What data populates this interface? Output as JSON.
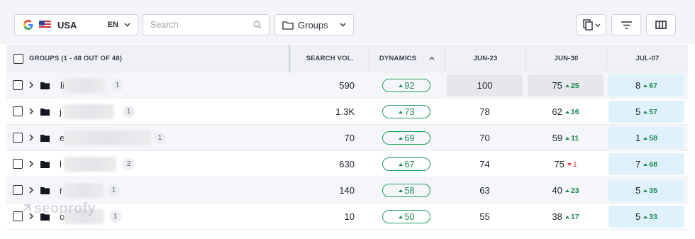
{
  "toolbar": {
    "country": "USA",
    "language": "EN",
    "search_placeholder": "Search",
    "groups_label": "Groups"
  },
  "table": {
    "headers": {
      "groups": "GROUPS (1 - 48 OUT OF 48)",
      "search_vol": "SEARCH VOL.",
      "dynamics": "DYNAMICS",
      "jun23": "JUN-23",
      "jun30": "JUN-30",
      "jul07": "JUL-07"
    },
    "rows": [
      {
        "name": "li",
        "count": "1",
        "vol": "590",
        "dyn": "92",
        "jun23": "100",
        "jun30": "75",
        "jun30_chg": "25",
        "jun30_dir": "up",
        "jul07": "8",
        "jul07_chg": "67"
      },
      {
        "name": "j",
        "count": "1",
        "vol": "1.3K",
        "dyn": "73",
        "jun23": "78",
        "jun30": "62",
        "jun30_chg": "16",
        "jun30_dir": "up",
        "jul07": "5",
        "jul07_chg": "57"
      },
      {
        "name": "e",
        "count": "1",
        "vol": "70",
        "dyn": "69",
        "jun23": "70",
        "jun30": "59",
        "jun30_chg": "11",
        "jun30_dir": "up",
        "jul07": "1",
        "jul07_chg": "58"
      },
      {
        "name": "l",
        "count": "2",
        "vol": "630",
        "dyn": "67",
        "jun23": "74",
        "jun30": "75",
        "jun30_chg": "1",
        "jun30_dir": "down",
        "jul07": "7",
        "jul07_chg": "68"
      },
      {
        "name": "r",
        "count": "1",
        "vol": "140",
        "dyn": "58",
        "jun23": "63",
        "jun30": "40",
        "jun30_chg": "23",
        "jun30_dir": "up",
        "jul07": "5",
        "jul07_chg": "35"
      },
      {
        "name": "o",
        "count": "1",
        "vol": "10",
        "dyn": "50",
        "jun23": "55",
        "jun30": "38",
        "jun30_chg": "17",
        "jun30_dir": "up",
        "jul07": "5",
        "jul07_chg": "33"
      }
    ]
  },
  "watermark": "seoprofy",
  "colors": {
    "positive": "#1b8a4f",
    "negative": "#e0303c",
    "highlight_cell": "#dff1fb"
  }
}
